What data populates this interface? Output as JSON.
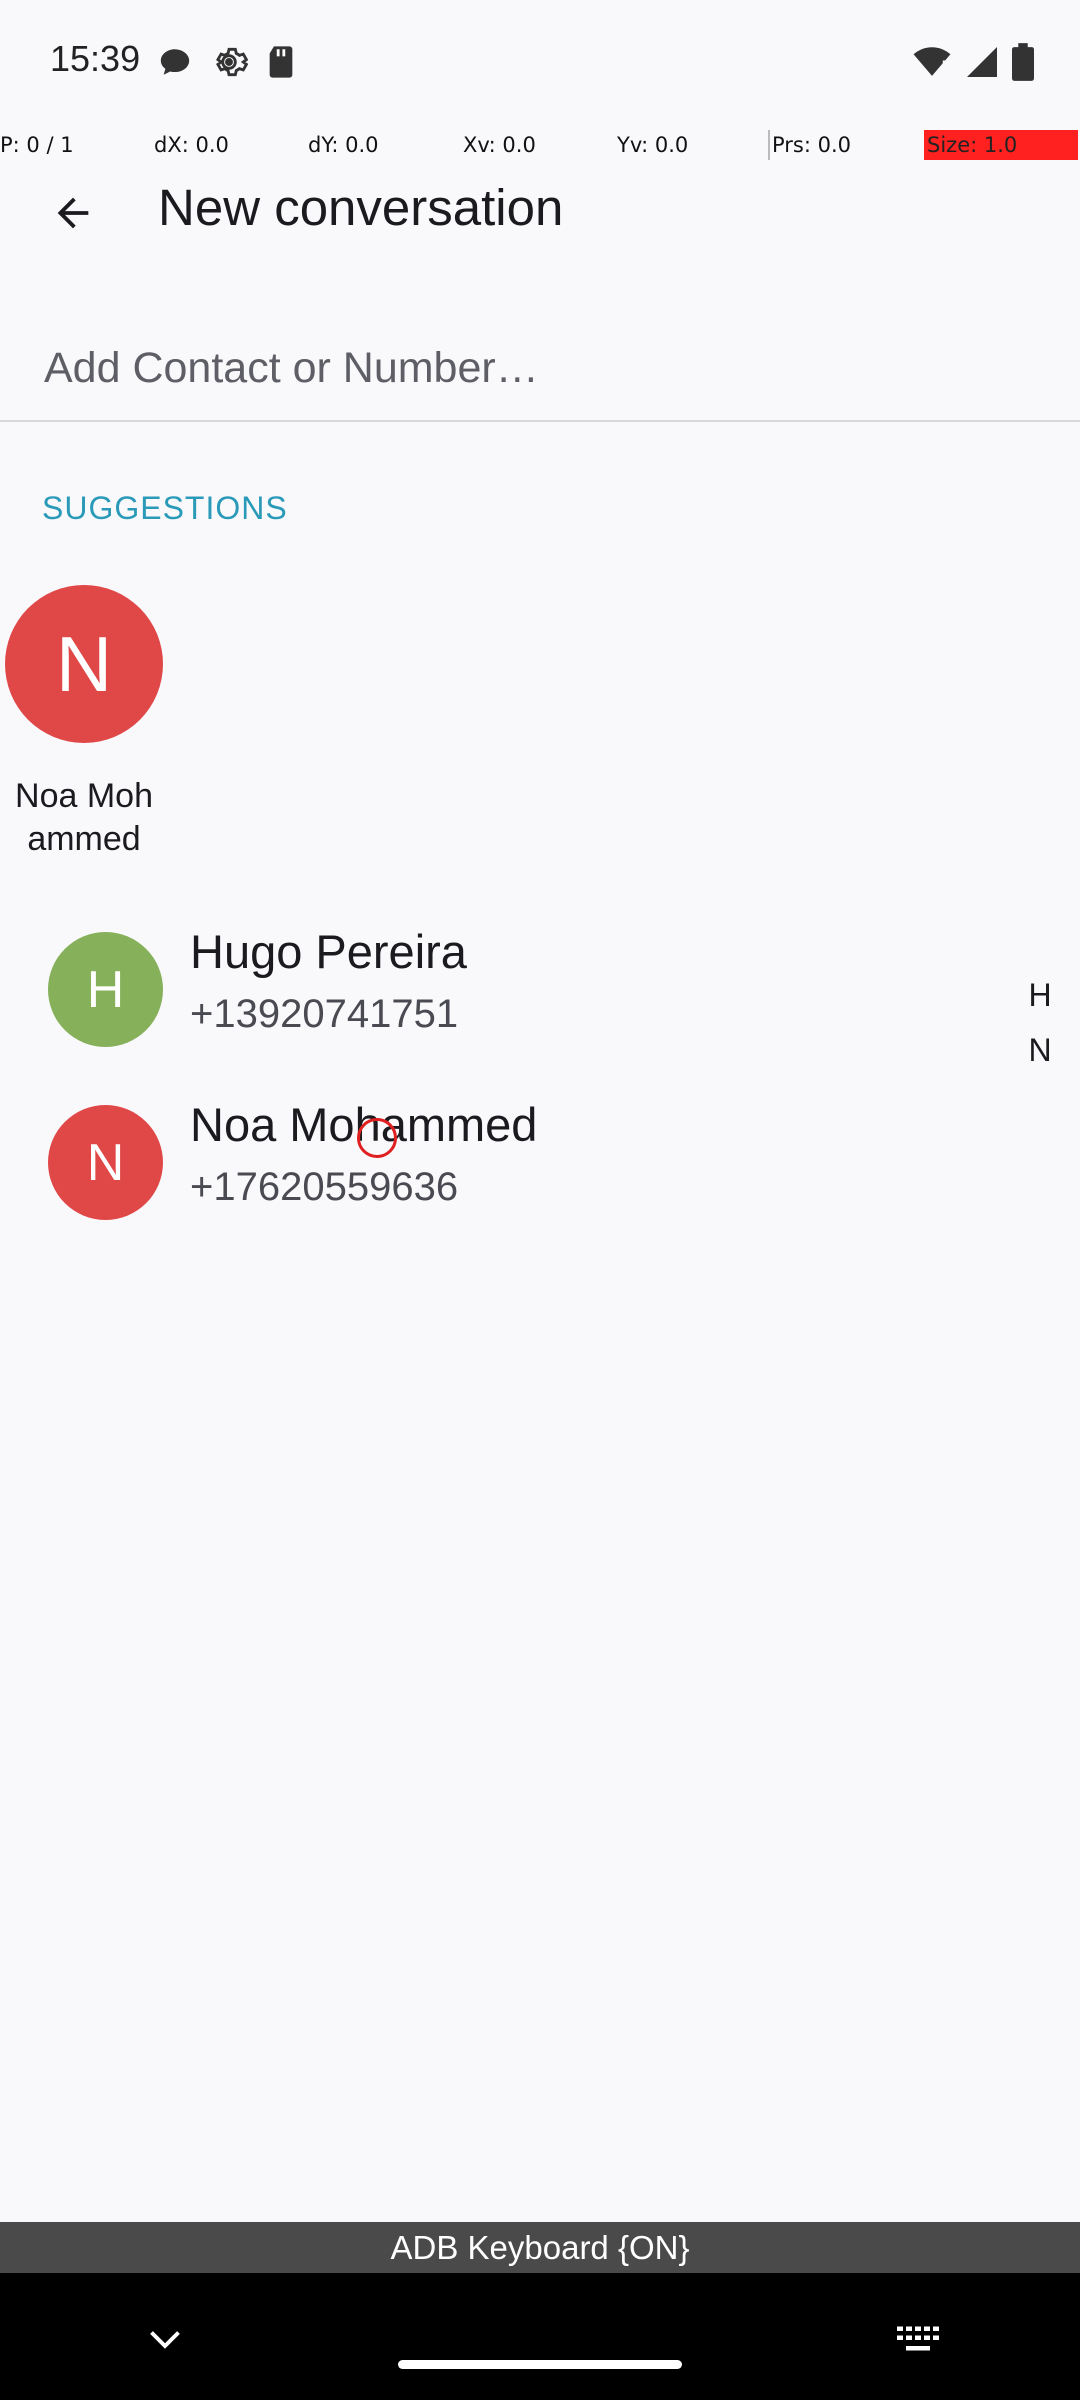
{
  "status_bar": {
    "time": "15:39"
  },
  "pointer_location": {
    "p": "P: 0 / 1",
    "dx": "dX: 0.0",
    "dy": "dY: 0.0",
    "xv": "Xv: 0.0",
    "yv": "Yv: 0.0",
    "prs": "Prs: 0.0",
    "size": "Size: 1.0"
  },
  "app_bar": {
    "title": "New conversation",
    "back_icon": "arrow-back-icon"
  },
  "contact_input": {
    "placeholder": "Add Contact or Number…",
    "value": ""
  },
  "suggestions": {
    "header": "SUGGESTIONS",
    "items": [
      {
        "initial": "N",
        "name_line1": "Noa Moh",
        "name_line2": "ammed",
        "color": "#e04747"
      }
    ]
  },
  "contacts": [
    {
      "initial": "H",
      "name": "Hugo Pereira",
      "number": "+13920741751",
      "color": "#86b05a"
    },
    {
      "initial": "N",
      "name": "Noa Mohammed",
      "number": "+17620559636",
      "color": "#e04747"
    }
  ],
  "fast_scroll": [
    "H",
    "N"
  ],
  "keyboard": {
    "banner": "ADB Keyboard {ON}",
    "collapse_icon": "chevron-down-icon",
    "switch_icon": "keyboard-icon"
  }
}
